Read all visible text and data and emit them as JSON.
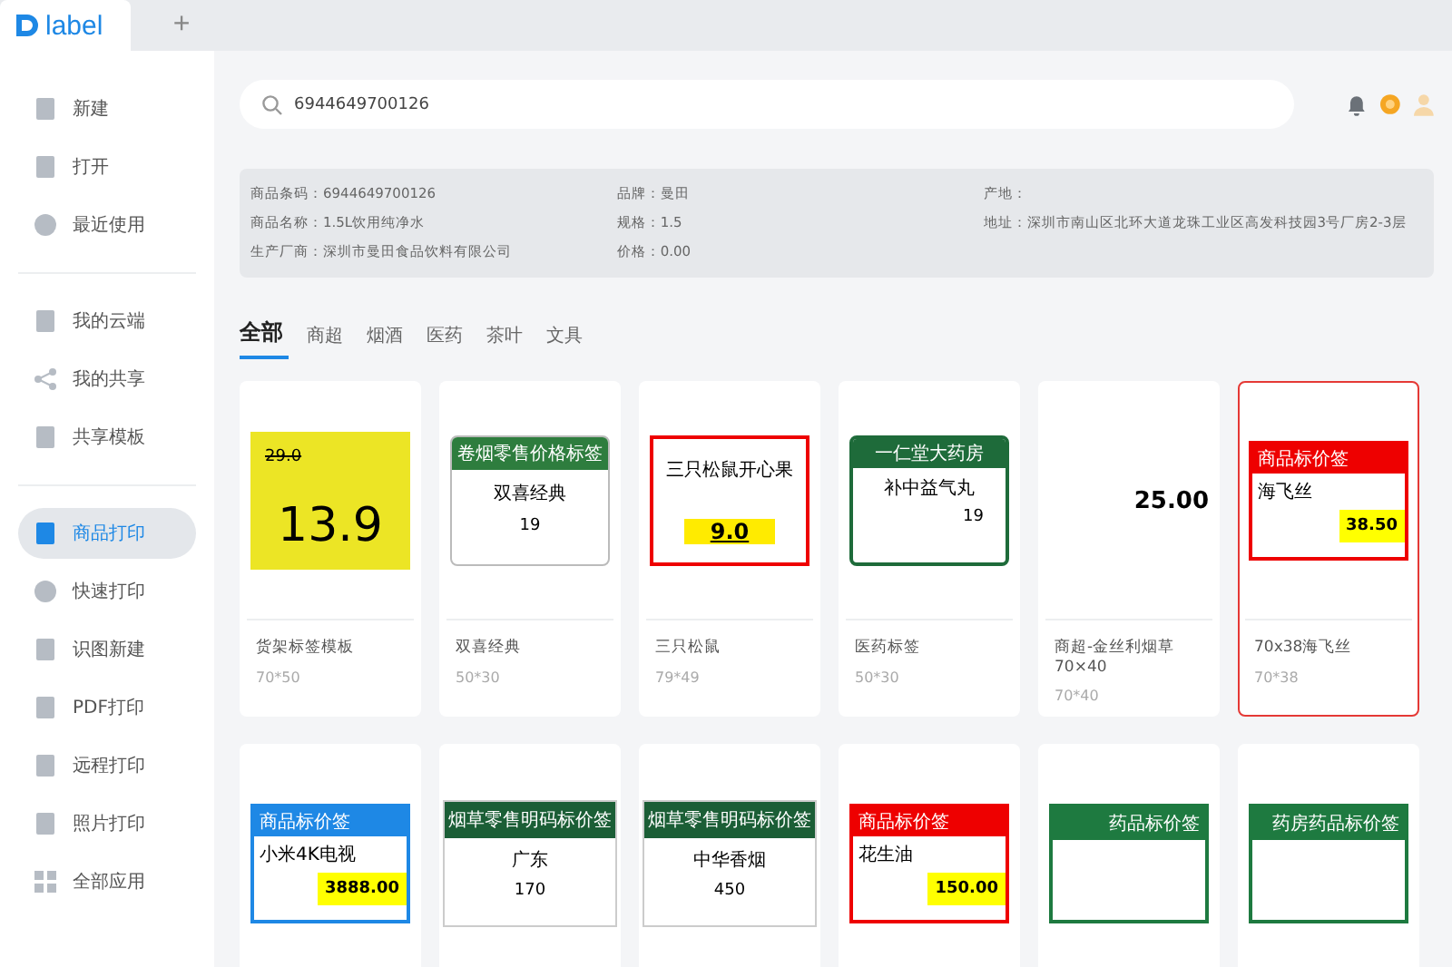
{
  "app_tabs": {
    "logo": "label",
    "add": "+"
  },
  "sidebar": {
    "groups": [
      [
        {
          "label": "新建",
          "selected": false
        },
        {
          "label": "打开",
          "selected": false
        },
        {
          "label": "最近使用",
          "selected": false
        }
      ],
      [
        {
          "label": "我的云端",
          "selected": false
        },
        {
          "label": "我的共享",
          "selected": false
        },
        {
          "label": "共享模板",
          "selected": false
        }
      ],
      [
        {
          "label": "商品打印",
          "selected": true
        },
        {
          "label": "快速打印",
          "selected": false
        },
        {
          "label": "识图新建",
          "selected": false
        },
        {
          "label": "PDF打印",
          "selected": false
        },
        {
          "label": "远程打印",
          "selected": false
        },
        {
          "label": "照片打印",
          "selected": false
        },
        {
          "label": "全部应用",
          "selected": false
        }
      ]
    ]
  },
  "search": {
    "value": "6944649700126"
  },
  "product_info": {
    "columns": [
      [
        "商品条码：6944649700126",
        "商品名称：1.5L饮用纯净水",
        "生产厂商：深圳市曼田食品饮料有限公司"
      ],
      [
        "品牌：曼田",
        "规格：1.5",
        "价格：0.00"
      ],
      [
        "产地：",
        "地址：深圳市南山区北环大道龙珠工业区高发科技园3号厂房2-3层"
      ]
    ]
  },
  "category_tabs": [
    {
      "label": "全部",
      "selected": true
    },
    {
      "label": "商超",
      "selected": false
    },
    {
      "label": "烟酒",
      "selected": false
    },
    {
      "label": "医药",
      "selected": false
    },
    {
      "label": "茶叶",
      "selected": false
    },
    {
      "label": "文具",
      "selected": false
    }
  ],
  "templates": [
    {
      "title": "货架标签模板",
      "size": "70*50",
      "selected": false,
      "preview": {
        "kind": "yellow",
        "name": "29.0",
        "price": "13.9"
      }
    },
    {
      "title": "双喜经典",
      "size": "50*30",
      "selected": false,
      "preview": {
        "kind": "tobacco",
        "header": "卷烟零售价格标签",
        "name": "双喜经典",
        "price": "19"
      }
    },
    {
      "title": "三只松鼠",
      "size": "79*49",
      "selected": false,
      "preview": {
        "kind": "redframe",
        "name": "三只松鼠开心果",
        "price": "9.0"
      }
    },
    {
      "title": "医药标签",
      "size": "50*30",
      "selected": false,
      "preview": {
        "kind": "pharma",
        "header": "一仁堂大药房",
        "name": "补中益气丸",
        "price": "19"
      }
    },
    {
      "title": "商超-金丝利烟草70×40",
      "size": "70*40",
      "selected": false,
      "preview": {
        "kind": "plain",
        "price": "25.00"
      }
    },
    {
      "title": "70x38海飞丝",
      "size": "70*38",
      "selected": true,
      "preview": {
        "kind": "tag-red",
        "header": "商品标价签",
        "name": "海飞丝",
        "price": "38.50"
      }
    },
    {
      "selected": false,
      "preview": {
        "kind": "tag-blue",
        "header": "商品标价签",
        "name": "小米4K电视",
        "price": "3888.00"
      }
    },
    {
      "selected": false,
      "preview": {
        "kind": "cigarette",
        "header": "烟草零售明码标价签",
        "name": "广东",
        "price": "170"
      }
    },
    {
      "selected": false,
      "preview": {
        "kind": "cigarette",
        "header": "烟草零售明码标价签",
        "name": "中华香烟",
        "price": "450"
      }
    },
    {
      "selected": false,
      "preview": {
        "kind": "tag-red",
        "header": "商品标价签",
        "name": "花生油",
        "price": "150.00"
      }
    },
    {
      "selected": false,
      "preview": {
        "kind": "green",
        "header": "药品标价签"
      }
    },
    {
      "selected": false,
      "preview": {
        "kind": "green",
        "header": "药房药品标价签"
      }
    }
  ]
}
